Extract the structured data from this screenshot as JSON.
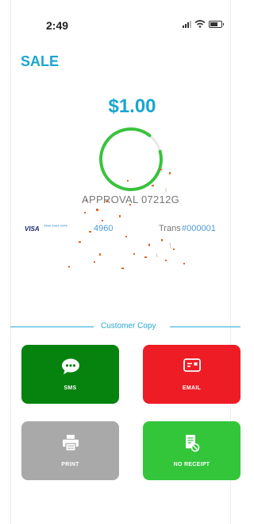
{
  "status_bar": {
    "time": "2:49"
  },
  "page": {
    "title": "SALE"
  },
  "transaction": {
    "amount": "$1.00",
    "approval": "APPROVAL 07212G",
    "card_brand": "VISA",
    "card_masked": "**** **** ****",
    "card_last4": "4960",
    "trans_label": "Trans",
    "trans_number": "#000001"
  },
  "receipt": {
    "divider_label": "Customer Copy",
    "buttons": {
      "sms": "SMS",
      "email": "EMAIL",
      "print": "PRINT",
      "no_receipt": "NO RECEIPT"
    }
  },
  "icons": {
    "sms": "chat-bubble-icon",
    "email": "email-card-icon",
    "print": "printer-icon",
    "no_receipt": "no-receipt-icon"
  },
  "colors": {
    "accent": "#1aa6cf",
    "ring": "#3ac23d",
    "sms": "#05830e",
    "email": "#ee1c25",
    "print": "#a9a9a9",
    "no_receipt": "#33c63b",
    "confetti": "#e0662a"
  }
}
